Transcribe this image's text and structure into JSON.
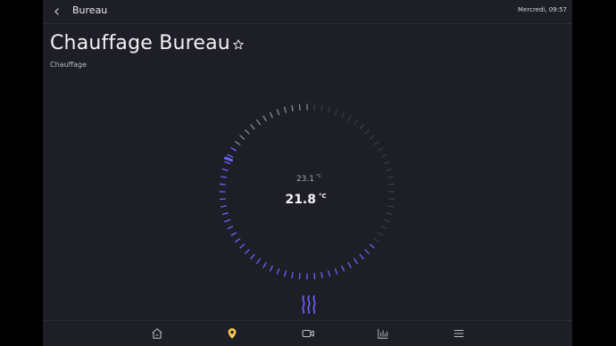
{
  "header": {
    "title": "Bureau",
    "datetime": "Mercredi, 09:57"
  },
  "page": {
    "title": "Chauffage Bureau",
    "subtitle": "Chauffage"
  },
  "thermostat": {
    "target_temp": "23.1",
    "target_unit": "°C",
    "current_temp": "21.8",
    "current_unit": "°C",
    "mode": "heat",
    "accent_color": "#6b63ff",
    "inactive_color": "#3a3a46"
  },
  "nav": {
    "items": [
      {
        "name": "home-icon",
        "active": false
      },
      {
        "name": "location-pin-icon",
        "active": true
      },
      {
        "name": "camera-icon",
        "active": false
      },
      {
        "name": "chart-icon",
        "active": false
      },
      {
        "name": "menu-icon",
        "active": false
      }
    ],
    "active_color": "#f2c94c"
  }
}
